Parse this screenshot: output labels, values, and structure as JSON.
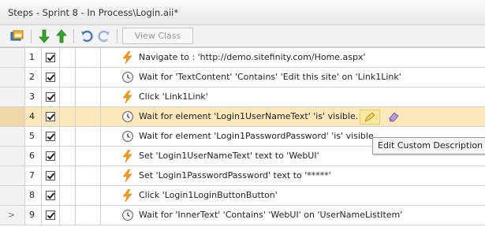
{
  "window": {
    "title": "Steps - Sprint 8 - In Process\\Login.aii*"
  },
  "toolbar": {
    "view_class_label": "View Class"
  },
  "rows": [
    {
      "num": "1",
      "icon": "lightning-icon",
      "text": "Navigate to : 'http://demo.sitefinity.com/Home.aspx'"
    },
    {
      "num": "2",
      "icon": "wait-clock-icon",
      "text": "Wait for 'TextContent' 'Contains' 'Edit this site' on 'Link1Link'"
    },
    {
      "num": "3",
      "icon": "lightning-icon",
      "text": "Click 'Link1Link'"
    },
    {
      "num": "4",
      "icon": "wait-clock-icon",
      "text": "Wait for element 'Login1UserNameText' 'is' visible."
    },
    {
      "num": "5",
      "icon": "wait-clock-icon",
      "text": "Wait for element 'Login1PasswordPassword' 'is' visible."
    },
    {
      "num": "6",
      "icon": "lightning-icon",
      "text": "Set 'Login1UserNameText' text to 'WebUI'"
    },
    {
      "num": "7",
      "icon": "lightning-icon",
      "text": "Set 'Login1PasswordPassword' text to '*****'"
    },
    {
      "num": "8",
      "icon": "lightning-icon",
      "text": "Click 'Login1LoginButtonButton'"
    },
    {
      "num": "9",
      "icon": "wait-clock-icon",
      "text": "Wait for 'InnerText' 'Contains' 'WebUI' on 'UserNameListItem'"
    }
  ],
  "row_indicator": ">",
  "tooltip": "Edit Custom Description",
  "colors": {
    "selected_row": "#fde8bb",
    "lightning": "#f39c1a",
    "arrow_green": "#3aa12c",
    "undo_blue": "#4a78c2"
  }
}
